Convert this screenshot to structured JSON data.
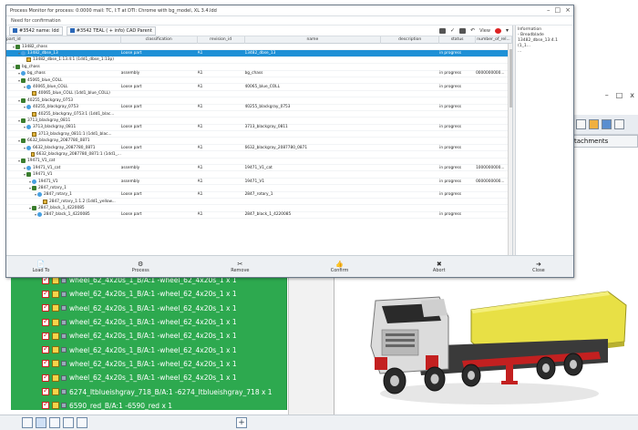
{
  "dialog": {
    "title": "Process Monitor for process: 0:0000 mail: TC, I:T at DTI: Chrome with bg_model, XL 3.4.ldd",
    "subtitle": "Need for confirmation",
    "breadcrumbs": [
      {
        "label": "#3542 name: ldd"
      },
      {
        "label": "#3542 TEAL ( + info) CAD Parent"
      }
    ],
    "view_label": "View",
    "columns": [
      "part_id",
      "classification",
      "revision_id",
      "name",
      "description",
      "status",
      "number_of_rel..."
    ],
    "rows": [
      {
        "indent": 1,
        "twisty": "▾",
        "icon": "asm",
        "part": "13482_chass",
        "class": "",
        "rev": "",
        "name": "",
        "desc": "",
        "status": "",
        "num": "",
        "selected": false
      },
      {
        "indent": 2,
        "twisty": "▾",
        "icon": "obj",
        "part": "13482_dbse_13",
        "class": "Loose part",
        "rev": "A1",
        "name": "13482_dbse_13",
        "desc": "",
        "status": "in progress",
        "num": "",
        "selected": true
      },
      {
        "indent": 3,
        "twisty": "",
        "icon": "part",
        "part": "13482_dbse_1:13.4:1 (1dd1_dbse_1:13p)",
        "class": "",
        "rev": "",
        "name": "",
        "desc": "",
        "status": "",
        "num": "",
        "selected": false
      },
      {
        "indent": 1,
        "twisty": "▾",
        "icon": "asm",
        "part": "bg_chass",
        "class": "",
        "rev": "",
        "name": "",
        "desc": "",
        "status": "",
        "num": "",
        "selected": false
      },
      {
        "indent": 2,
        "twisty": "▾",
        "icon": "obj",
        "part": "bg_chass",
        "class": "assembly",
        "rev": "A1",
        "name": "bg_chass",
        "desc": "",
        "status": "in progress",
        "num": "0000000000...",
        "selected": false
      },
      {
        "indent": 2,
        "twisty": "▾",
        "icon": "asm",
        "part": "45065_blue_COLL",
        "class": "",
        "rev": "",
        "name": "",
        "desc": "",
        "status": "",
        "num": "",
        "selected": false
      },
      {
        "indent": 3,
        "twisty": "▾",
        "icon": "obj",
        "part": "40065_blue_COLL",
        "class": "Loose part",
        "rev": "A1",
        "name": "40065_blue_COLL",
        "desc": "",
        "status": "in progress",
        "num": "",
        "selected": false
      },
      {
        "indent": 4,
        "twisty": "",
        "icon": "part",
        "part": "40065_blue_COLL (1dd1_blue_COLL)",
        "class": "",
        "rev": "",
        "name": "",
        "desc": "",
        "status": "",
        "num": "",
        "selected": false
      },
      {
        "indent": 2,
        "twisty": "▾",
        "icon": "asm",
        "part": "40255_blackgray_0753",
        "class": "",
        "rev": "",
        "name": "",
        "desc": "",
        "status": "",
        "num": "",
        "selected": false
      },
      {
        "indent": 3,
        "twisty": "▾",
        "icon": "obj",
        "part": "40255_blackgray_0753",
        "class": "Loose part",
        "rev": "A1",
        "name": "40255_blackgray_0753",
        "desc": "",
        "status": "in progress",
        "num": "",
        "selected": false
      },
      {
        "indent": 4,
        "twisty": "",
        "icon": "part",
        "part": "40255_blackgray_0753:1 (1dd1_blac...",
        "class": "",
        "rev": "",
        "name": "",
        "desc": "",
        "status": "",
        "num": "",
        "selected": false
      },
      {
        "indent": 2,
        "twisty": "▾",
        "icon": "asm",
        "part": "3713_blackgray_0811",
        "class": "",
        "rev": "",
        "name": "",
        "desc": "",
        "status": "",
        "num": "",
        "selected": false
      },
      {
        "indent": 3,
        "twisty": "▾",
        "icon": "obj",
        "part": "3713_blackgray_0811",
        "class": "Loose part",
        "rev": "A1",
        "name": "3713_blackgray_0811",
        "desc": "",
        "status": "in progress",
        "num": "",
        "selected": false
      },
      {
        "indent": 4,
        "twisty": "",
        "icon": "part",
        "part": "3713_blackgray_0811:1 (1dd1_blac...",
        "class": "",
        "rev": "",
        "name": "",
        "desc": "",
        "status": "",
        "num": "",
        "selected": false
      },
      {
        "indent": 2,
        "twisty": "▾",
        "icon": "asm",
        "part": "6632_blackgray_2087780_0871",
        "class": "",
        "rev": "",
        "name": "",
        "desc": "",
        "status": "",
        "num": "",
        "selected": false
      },
      {
        "indent": 3,
        "twisty": "▾",
        "icon": "obj",
        "part": "6632_blackgray_2087780_0871",
        "class": "Loose part",
        "rev": "A1",
        "name": "6632_blackgray_2087780_0871",
        "desc": "",
        "status": "in progress",
        "num": "",
        "selected": false
      },
      {
        "indent": 4,
        "twisty": "",
        "icon": "part",
        "part": "6632_blackgray_2087780_0871:1 (1dd1_...",
        "class": "",
        "rev": "",
        "name": "",
        "desc": "",
        "status": "",
        "num": "",
        "selected": false
      },
      {
        "indent": 2,
        "twisty": "▾",
        "icon": "asm",
        "part": "19471_V1_cat",
        "class": "",
        "rev": "",
        "name": "",
        "desc": "",
        "status": "",
        "num": "",
        "selected": false
      },
      {
        "indent": 3,
        "twisty": "▾",
        "icon": "obj",
        "part": "19471_V1_cat",
        "class": "assembly",
        "rev": "A1",
        "name": "19471_V1_cat",
        "desc": "",
        "status": "in progress",
        "num": "1000000000...",
        "selected": false
      },
      {
        "indent": 3,
        "twisty": "▾",
        "icon": "asm",
        "part": "19471_V1",
        "class": "",
        "rev": "",
        "name": "",
        "desc": "",
        "status": "",
        "num": "",
        "selected": false
      },
      {
        "indent": 4,
        "twisty": "▾",
        "icon": "obj",
        "part": "19471_V1",
        "class": "assembly",
        "rev": "A1",
        "name": "19471_V1",
        "desc": "",
        "status": "in progress",
        "num": "0000000000...",
        "selected": false
      },
      {
        "indent": 4,
        "twisty": "▾",
        "icon": "asm",
        "part": "2847_rotary_1",
        "class": "",
        "rev": "",
        "name": "",
        "desc": "",
        "status": "",
        "num": "",
        "selected": false
      },
      {
        "indent": 5,
        "twisty": "▾",
        "icon": "obj",
        "part": "2847_rotary_1",
        "class": "Loose part",
        "rev": "A1",
        "name": "2847_rotary_1",
        "desc": "",
        "status": "in progress",
        "num": "",
        "selected": false
      },
      {
        "indent": 6,
        "twisty": "",
        "icon": "part",
        "part": "2847_rotary_1:1.2 (1dd1_yellow...",
        "class": "",
        "rev": "",
        "name": "",
        "desc": "",
        "status": "",
        "num": "",
        "selected": false
      },
      {
        "indent": 4,
        "twisty": "▾",
        "icon": "asm",
        "part": "2847_black_1_4220085",
        "class": "",
        "rev": "",
        "name": "",
        "desc": "",
        "status": "",
        "num": "",
        "selected": false
      },
      {
        "indent": 5,
        "twisty": "▾",
        "icon": "obj",
        "part": "2847_black_1_4220085",
        "class": "Loose part",
        "rev": "A1",
        "name": "2847_black_1_4220085",
        "desc": "",
        "status": "in progress",
        "num": "",
        "selected": false
      }
    ],
    "side_panel": {
      "heading": "Information",
      "lines": [
        "- Breadblade",
        "13482_dbse_13:4.1 (1_1...",
        "..."
      ]
    },
    "actions": [
      {
        "icon": "📄",
        "label": "Load To"
      },
      {
        "icon": "⚙",
        "label": "Process"
      },
      {
        "icon": "✂",
        "label": "Remove"
      },
      {
        "icon": "👍",
        "label": "Confirm"
      },
      {
        "icon": "✖",
        "label": "Abort"
      },
      {
        "icon": "➜",
        "label": "Close"
      }
    ]
  },
  "background_app": {
    "window_controls": [
      "–",
      "□",
      "x"
    ],
    "tab_label": "tachments",
    "parts_list": [
      "wheel_62_4x20s_1_B/A:1 -wheel_62_4x20s_1 x 1",
      "wheel_62_4x20s_1_B/A:1 -wheel_62_4x20s_1 x 1",
      "wheel_62_4x20s_1_B/A:1 -wheel_62_4x20s_1 x 1",
      "wheel_62_4x20s_1_B/A:1 -wheel_62_4x20s_1 x 1",
      "wheel_62_4x20s_1_B/A:1 -wheel_62_4x20s_1 x 1",
      "wheel_62_4x20s_1_B/A:1 -wheel_62_4x20s_1 x 1",
      "wheel_62_4x20s_1_B/A:1 -wheel_62_4x20s_1 x 1",
      "wheel_62_4x20s_1_B/A:1 -wheel_62_4x20s_1 x 1",
      "6274_Itblueishgray_718_B/A:1 -6274_Itblueishgray_718 x 1",
      "6590_red_B/A:1 -6590_red x 1"
    ]
  },
  "colors": {
    "selection": "#1e90d6",
    "list_green": "#2da94f",
    "truck_yellow": "#e8e045",
    "truck_red": "#c32020"
  }
}
